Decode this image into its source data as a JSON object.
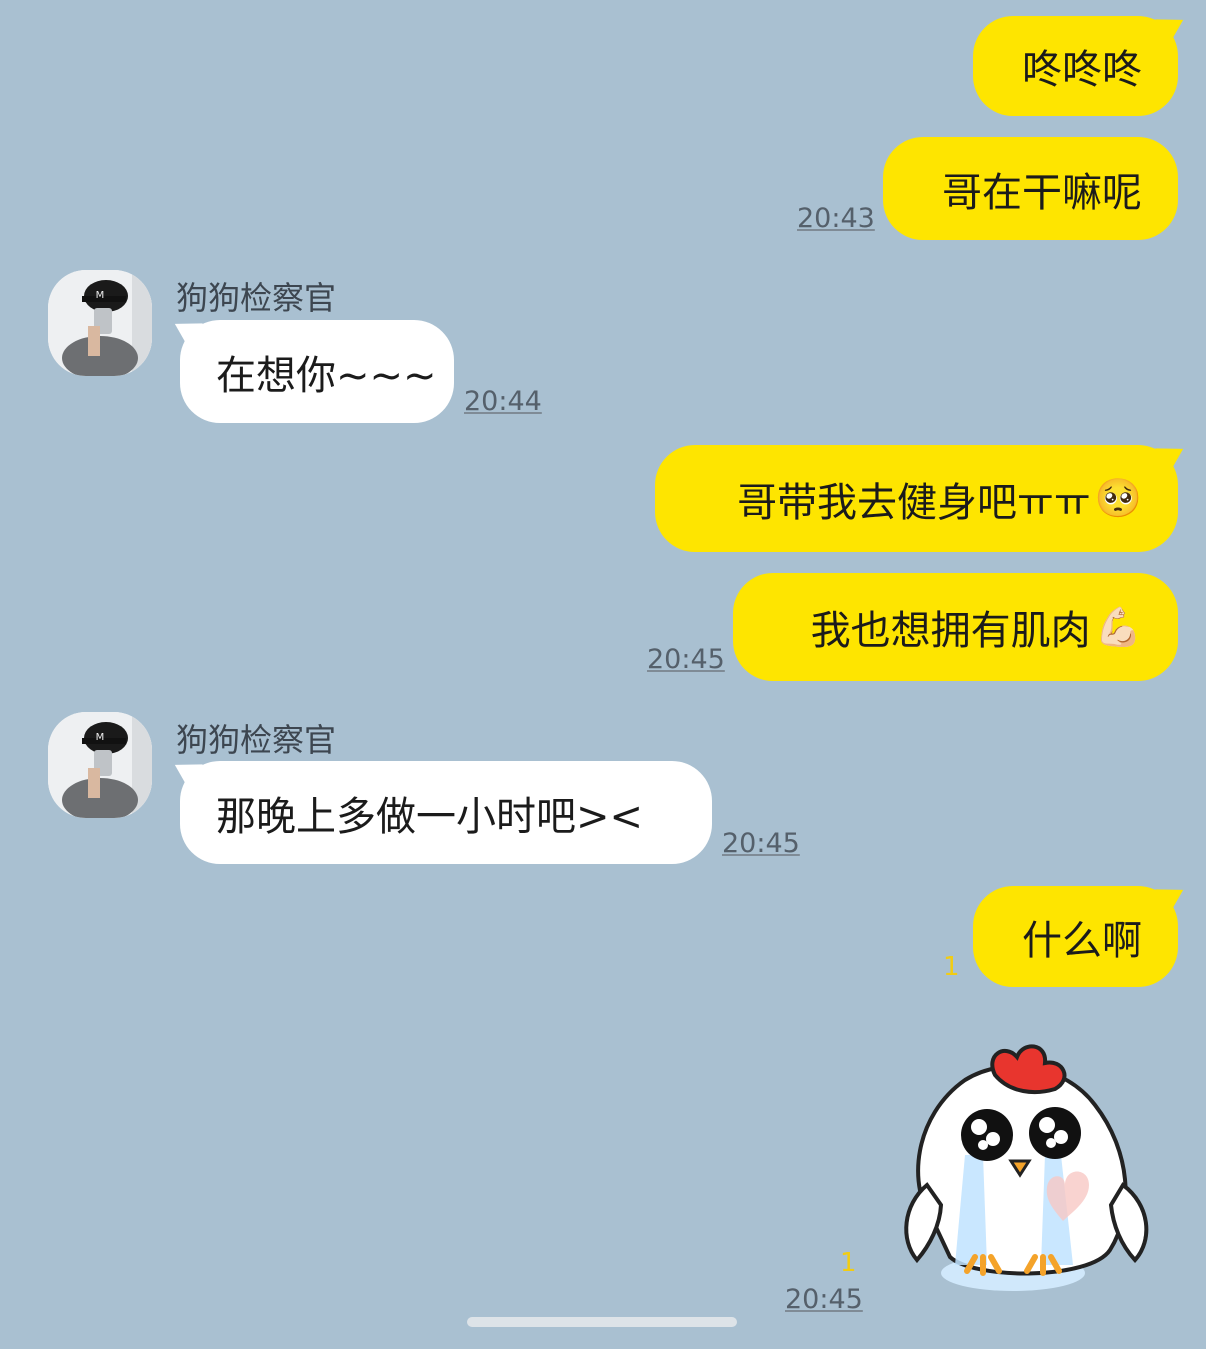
{
  "contact": {
    "name": "狗狗检察官"
  },
  "messages": [
    {
      "text": "咚咚咚"
    },
    {
      "text": "哥在干嘛呢",
      "time": "20:43"
    },
    {
      "text": "在想你~~~",
      "time": "20:44"
    },
    {
      "text": "哥带我去健身吧ㅠㅠ",
      "emoji": "🥺"
    },
    {
      "text": "我也想拥有肌肉",
      "emoji": "💪🏻",
      "time": "20:45"
    },
    {
      "text": "那晚上多做一小时吧><",
      "time": "20:45"
    },
    {
      "text": "什么啊",
      "unread": "1"
    },
    {
      "sticker": "crying-chicken-sticker",
      "unread": "1",
      "time": "20:45"
    }
  ],
  "colors": {
    "background": "#a9c0d1",
    "outgoing": "#fee500",
    "incoming": "#ffffff"
  }
}
